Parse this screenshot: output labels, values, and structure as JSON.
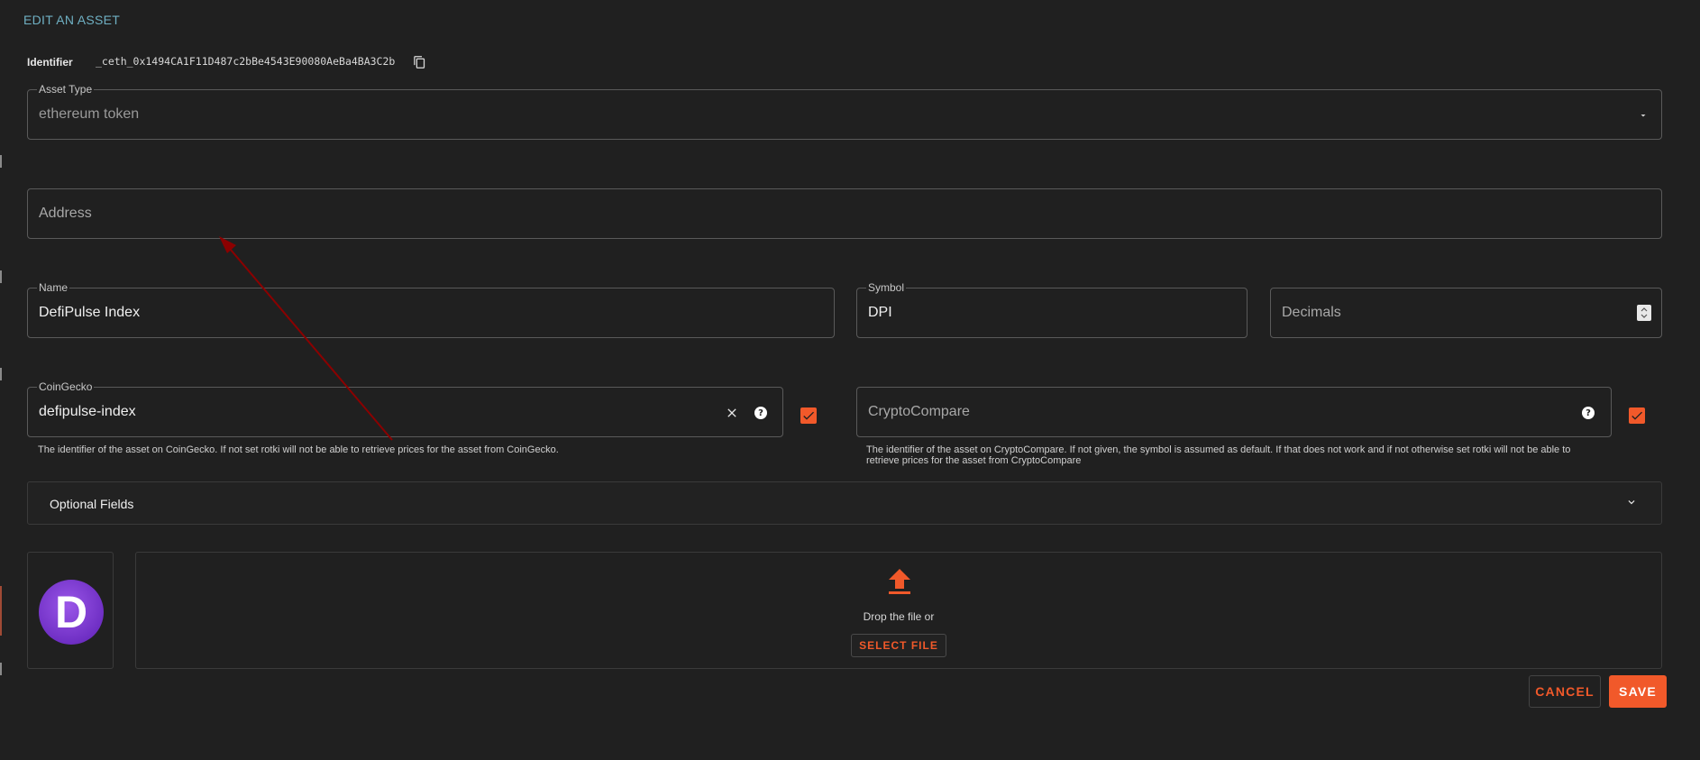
{
  "dialog": {
    "title": "EDIT AN ASSET"
  },
  "identifier": {
    "label": "Identifier",
    "value": "_ceth_0x1494CA1F11D487c2bBe4543E90080AeBa4BA3C2b",
    "copy_icon": "copy-icon"
  },
  "asset_type": {
    "label": "Asset Type",
    "value": "ethereum token",
    "icon": "chevron-down-icon"
  },
  "address": {
    "placeholder": "Address",
    "value": ""
  },
  "name": {
    "label": "Name",
    "value": "DefiPulse Index"
  },
  "symbol": {
    "label": "Symbol",
    "value": "DPI"
  },
  "decimals": {
    "placeholder": "Decimals",
    "value": ""
  },
  "coingecko": {
    "label": "CoinGecko",
    "value": "defipulse-index",
    "hint": "The identifier of the asset on CoinGecko. If not set rotki will not be able to retrieve prices for the asset from CoinGecko.",
    "checked": true
  },
  "cryptocompare": {
    "placeholder": "CryptoCompare",
    "value": "",
    "hint": "The identifier of the asset on CryptoCompare. If not given, the symbol is assumed as default. If that does not work and if not otherwise set rotki will not be able to retrieve prices for the asset from CryptoCompare",
    "checked": true
  },
  "optional_fields": {
    "title": "Optional Fields"
  },
  "icon_preview": {
    "letter": "D"
  },
  "upload": {
    "drop_text": "Drop the file or",
    "select_label": "SELECT FILE"
  },
  "actions": {
    "cancel_label": "CANCEL",
    "save_label": "SAVE"
  },
  "colors": {
    "accent": "#f1592a",
    "title": "#6fb0c3",
    "background": "#202020",
    "annotation_arrow": "#8b0000"
  }
}
